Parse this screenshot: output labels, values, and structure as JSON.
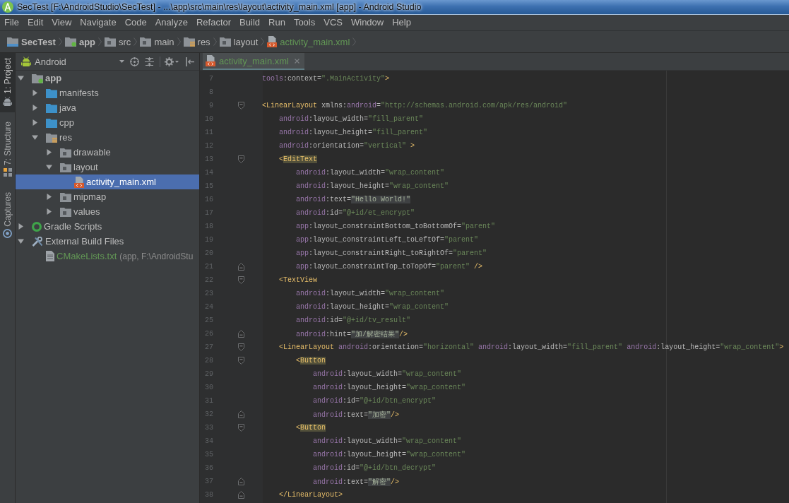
{
  "window": {
    "title": "SecTest [F:\\AndroidStudio\\SecTest] - ...\\app\\src\\main\\res\\layout\\activity_main.xml [app] - Android Studio"
  },
  "menu": [
    "File",
    "Edit",
    "View",
    "Navigate",
    "Code",
    "Analyze",
    "Refactor",
    "Build",
    "Run",
    "Tools",
    "VCS",
    "Window",
    "Help"
  ],
  "breadcrumbs": [
    {
      "label": "SecTest",
      "kind": "project",
      "added": false
    },
    {
      "label": "app",
      "kind": "module",
      "added": false
    },
    {
      "label": "src",
      "kind": "folder",
      "added": false
    },
    {
      "label": "main",
      "kind": "folder",
      "added": false
    },
    {
      "label": "res",
      "kind": "res-folder",
      "added": false
    },
    {
      "label": "layout",
      "kind": "folder",
      "added": false
    },
    {
      "label": "activity_main.xml",
      "kind": "layout-file",
      "added": true
    }
  ],
  "tool_windows": [
    {
      "label": "1: Project",
      "selected": true
    },
    {
      "label": "7: Structure",
      "selected": false
    },
    {
      "label": "Captures",
      "selected": false
    }
  ],
  "project_panel": {
    "view": "Android",
    "tree": [
      {
        "label": "app",
        "kind": "module",
        "expanded": true,
        "selected": false,
        "added": false,
        "children": [
          {
            "label": "manifests",
            "kind": "source-folder",
            "expanded": false,
            "selected": false,
            "added": false
          },
          {
            "label": "java",
            "kind": "source-folder",
            "expanded": false,
            "selected": false,
            "added": false
          },
          {
            "label": "cpp",
            "kind": "source-folder",
            "expanded": false,
            "selected": false,
            "added": false
          },
          {
            "label": "res",
            "kind": "res-folder",
            "expanded": true,
            "selected": false,
            "added": false,
            "children": [
              {
                "label": "drawable",
                "kind": "folder",
                "expanded": false,
                "selected": false,
                "added": false
              },
              {
                "label": "layout",
                "kind": "folder",
                "expanded": true,
                "selected": false,
                "added": false,
                "children": [
                  {
                    "label": "activity_main.xml",
                    "kind": "layout-file",
                    "selected": true,
                    "added": false
                  }
                ]
              },
              {
                "label": "mipmap",
                "kind": "folder",
                "expanded": false,
                "selected": false,
                "added": false
              },
              {
                "label": "values",
                "kind": "folder",
                "expanded": false,
                "selected": false,
                "added": false
              }
            ]
          }
        ]
      },
      {
        "label": "Gradle Scripts",
        "kind": "gradle",
        "expanded": false,
        "selected": false,
        "added": false
      },
      {
        "label": "External Build Files",
        "kind": "external",
        "expanded": true,
        "selected": false,
        "added": false,
        "children": [
          {
            "label": "CMakeLists.txt",
            "detail": "(app, F:\\AndroidStu",
            "kind": "text-file",
            "selected": false,
            "added": true
          }
        ]
      }
    ]
  },
  "editor": {
    "tabs": [
      {
        "label": "activity_main.xml",
        "selected": true,
        "added": true
      }
    ],
    "lines": [
      {
        "number": "7",
        "kind": "plain",
        "tokens": [
          {
            "kind": "ns",
            "text": "tools"
          },
          {
            "kind": "attr",
            "text": ":context="
          },
          {
            "kind": "value",
            "text": "\".MainActivity\""
          },
          {
            "kind": "punct",
            "text": ">"
          }
        ]
      },
      {
        "number": "8",
        "kind": "plain"
      },
      {
        "number": "9",
        "kind": "fold-start",
        "tokens": [
          {
            "kind": "punct",
            "text": "<"
          },
          {
            "kind": "tag",
            "text": "LinearLayout"
          },
          {
            "kind": "attr",
            "text": " xmlns:"
          },
          {
            "kind": "ns",
            "text": "android"
          },
          {
            "kind": "attr",
            "text": "="
          },
          {
            "kind": "value",
            "text": "\"http://schemas.android.com/apk/res/android\""
          }
        ],
        "children": [
          {
            "number": "10",
            "kind": "plain",
            "tokens": [
              {
                "kind": "ns",
                "text": "android"
              },
              {
                "kind": "attr",
                "text": ":layout_width="
              },
              {
                "kind": "value",
                "text": "\"fill_parent\""
              }
            ]
          },
          {
            "number": "11",
            "kind": "plain",
            "tokens": [
              {
                "kind": "ns",
                "text": "android"
              },
              {
                "kind": "attr",
                "text": ":layout_height="
              },
              {
                "kind": "value",
                "text": "\"fill_parent\""
              }
            ]
          },
          {
            "number": "12",
            "kind": "plain",
            "tokens": [
              {
                "kind": "ns",
                "text": "android"
              },
              {
                "kind": "attr",
                "text": ":orientation="
              },
              {
                "kind": "value",
                "text": "\"vertical\""
              },
              {
                "kind": "punct",
                "text": " >"
              }
            ]
          },
          {
            "number": "13",
            "kind": "fold-start",
            "tokens": [
              {
                "kind": "punct",
                "text": "<"
              },
              {
                "kind": "tag-match",
                "text": "EditText"
              }
            ],
            "children": [
              {
                "number": "14",
                "kind": "plain",
                "tokens": [
                  {
                    "kind": "ns",
                    "text": "android"
                  },
                  {
                    "kind": "attr",
                    "text": ":layout_width="
                  },
                  {
                    "kind": "value",
                    "text": "\"wrap_content\""
                  }
                ]
              },
              {
                "number": "15",
                "kind": "plain",
                "tokens": [
                  {
                    "kind": "ns",
                    "text": "android"
                  },
                  {
                    "kind": "attr",
                    "text": ":layout_height="
                  },
                  {
                    "kind": "value",
                    "text": "\"wrap_content\""
                  }
                ]
              },
              {
                "number": "16",
                "kind": "plain",
                "tokens": [
                  {
                    "kind": "ns",
                    "text": "android"
                  },
                  {
                    "kind": "attr",
                    "text": ":text="
                  },
                  {
                    "kind": "value-literal",
                    "text": "\"Hello World!\""
                  }
                ]
              },
              {
                "number": "17",
                "kind": "plain",
                "tokens": [
                  {
                    "kind": "ns",
                    "text": "android"
                  },
                  {
                    "kind": "attr",
                    "text": ":id="
                  },
                  {
                    "kind": "value",
                    "text": "\"@+id/et_encrypt\""
                  }
                ]
              },
              {
                "number": "18",
                "kind": "plain",
                "tokens": [
                  {
                    "kind": "ns",
                    "text": "app"
                  },
                  {
                    "kind": "attr",
                    "text": ":layout_constraintBottom_toBottomOf="
                  },
                  {
                    "kind": "value",
                    "text": "\"parent\""
                  }
                ]
              },
              {
                "number": "19",
                "kind": "plain",
                "tokens": [
                  {
                    "kind": "ns",
                    "text": "app"
                  },
                  {
                    "kind": "attr",
                    "text": ":layout_constraintLeft_toLeftOf="
                  },
                  {
                    "kind": "value",
                    "text": "\"parent\""
                  }
                ]
              },
              {
                "number": "20",
                "kind": "plain",
                "tokens": [
                  {
                    "kind": "ns",
                    "text": "app"
                  },
                  {
                    "kind": "attr",
                    "text": ":layout_constraintRight_toRightOf="
                  },
                  {
                    "kind": "value",
                    "text": "\"parent\""
                  }
                ]
              },
              {
                "number": "21",
                "kind": "fold-end",
                "tokens": [
                  {
                    "kind": "ns",
                    "text": "app"
                  },
                  {
                    "kind": "attr",
                    "text": ":layout_constraintTop_toTopOf="
                  },
                  {
                    "kind": "value",
                    "text": "\"parent\""
                  },
                  {
                    "kind": "punct",
                    "text": " />"
                  }
                ]
              }
            ]
          },
          {
            "number": "22",
            "kind": "fold-start",
            "tokens": [
              {
                "kind": "punct",
                "text": "<"
              },
              {
                "kind": "tag",
                "text": "TextView"
              }
            ],
            "children": [
              {
                "number": "23",
                "kind": "plain",
                "tokens": [
                  {
                    "kind": "ns",
                    "text": "android"
                  },
                  {
                    "kind": "attr",
                    "text": ":layout_width="
                  },
                  {
                    "kind": "value",
                    "text": "\"wrap_content\""
                  }
                ]
              },
              {
                "number": "24",
                "kind": "plain",
                "tokens": [
                  {
                    "kind": "ns",
                    "text": "android"
                  },
                  {
                    "kind": "attr",
                    "text": ":layout_height="
                  },
                  {
                    "kind": "value",
                    "text": "\"wrap_content\""
                  }
                ]
              },
              {
                "number": "25",
                "kind": "plain",
                "tokens": [
                  {
                    "kind": "ns",
                    "text": "android"
                  },
                  {
                    "kind": "attr",
                    "text": ":id="
                  },
                  {
                    "kind": "value",
                    "text": "\"@+id/tv_result\""
                  }
                ]
              },
              {
                "number": "26",
                "kind": "fold-end",
                "tokens": [
                  {
                    "kind": "ns",
                    "text": "android"
                  },
                  {
                    "kind": "attr",
                    "text": ":hint="
                  },
                  {
                    "kind": "value-literal",
                    "text": "\"加/解密结果\""
                  },
                  {
                    "kind": "punct",
                    "text": "/>"
                  }
                ]
              }
            ]
          },
          {
            "number": "27",
            "kind": "fold-start",
            "tokens": [
              {
                "kind": "punct",
                "text": "<"
              },
              {
                "kind": "tag",
                "text": "LinearLayout"
              },
              {
                "kind": "ns",
                "text": " android"
              },
              {
                "kind": "attr",
                "text": ":orientation="
              },
              {
                "kind": "value",
                "text": "\"horizontal\""
              },
              {
                "kind": "ns",
                "text": " android"
              },
              {
                "kind": "attr",
                "text": ":layout_width="
              },
              {
                "kind": "value",
                "text": "\"fill_parent\""
              },
              {
                "kind": "ns",
                "text": " android"
              },
              {
                "kind": "attr",
                "text": ":layout_height="
              },
              {
                "kind": "value",
                "text": "\"wrap_content\""
              },
              {
                "kind": "punct",
                "text": ">"
              }
            ],
            "children": [
              {
                "number": "28",
                "kind": "fold-start",
                "tokens": [
                  {
                    "kind": "punct",
                    "text": "<"
                  },
                  {
                    "kind": "tag-match",
                    "text": "Button"
                  }
                ],
                "children": [
                  {
                    "number": "29",
                    "kind": "plain",
                    "tokens": [
                      {
                        "kind": "ns",
                        "text": "android"
                      },
                      {
                        "kind": "attr",
                        "text": ":layout_width="
                      },
                      {
                        "kind": "value",
                        "text": "\"wrap_content\""
                      }
                    ]
                  },
                  {
                    "number": "30",
                    "kind": "plain",
                    "tokens": [
                      {
                        "kind": "ns",
                        "text": "android"
                      },
                      {
                        "kind": "attr",
                        "text": ":layout_height="
                      },
                      {
                        "kind": "value",
                        "text": "\"wrap_content\""
                      }
                    ]
                  },
                  {
                    "number": "31",
                    "kind": "plain",
                    "tokens": [
                      {
                        "kind": "ns",
                        "text": "android"
                      },
                      {
                        "kind": "attr",
                        "text": ":id="
                      },
                      {
                        "kind": "value",
                        "text": "\"@+id/btn_encrypt\""
                      }
                    ]
                  },
                  {
                    "number": "32",
                    "kind": "fold-end",
                    "tokens": [
                      {
                        "kind": "ns",
                        "text": "android"
                      },
                      {
                        "kind": "attr",
                        "text": ":text="
                      },
                      {
                        "kind": "value-literal",
                        "text": "\"加密\""
                      },
                      {
                        "kind": "punct",
                        "text": "/>"
                      }
                    ]
                  }
                ]
              },
              {
                "number": "33",
                "kind": "fold-start",
                "tokens": [
                  {
                    "kind": "punct",
                    "text": "<"
                  },
                  {
                    "kind": "tag-match",
                    "text": "Button"
                  }
                ],
                "children": [
                  {
                    "number": "34",
                    "kind": "plain",
                    "tokens": [
                      {
                        "kind": "ns",
                        "text": "android"
                      },
                      {
                        "kind": "attr",
                        "text": ":layout_width="
                      },
                      {
                        "kind": "value",
                        "text": "\"wrap_content\""
                      }
                    ]
                  },
                  {
                    "number": "35",
                    "kind": "plain",
                    "tokens": [
                      {
                        "kind": "ns",
                        "text": "android"
                      },
                      {
                        "kind": "attr",
                        "text": ":layout_height="
                      },
                      {
                        "kind": "value",
                        "text": "\"wrap_content\""
                      }
                    ]
                  },
                  {
                    "number": "36",
                    "kind": "plain",
                    "tokens": [
                      {
                        "kind": "ns",
                        "text": "android"
                      },
                      {
                        "kind": "attr",
                        "text": ":id="
                      },
                      {
                        "kind": "value",
                        "text": "\"@+id/btn_decrypt\""
                      }
                    ]
                  },
                  {
                    "number": "37",
                    "kind": "fold-end",
                    "tokens": [
                      {
                        "kind": "ns",
                        "text": "android"
                      },
                      {
                        "kind": "attr",
                        "text": ":text="
                      },
                      {
                        "kind": "value-literal",
                        "text": "\"解密\""
                      },
                      {
                        "kind": "punct",
                        "text": "/>"
                      }
                    ]
                  }
                ]
              }
            ]
          },
          {
            "number": "38",
            "kind": "fold-end",
            "tokens": [
              {
                "kind": "punct",
                "text": "</"
              },
              {
                "kind": "tag",
                "text": "LinearLayout"
              },
              {
                "kind": "punct",
                "text": ">"
              }
            ]
          }
        ]
      }
    ]
  }
}
